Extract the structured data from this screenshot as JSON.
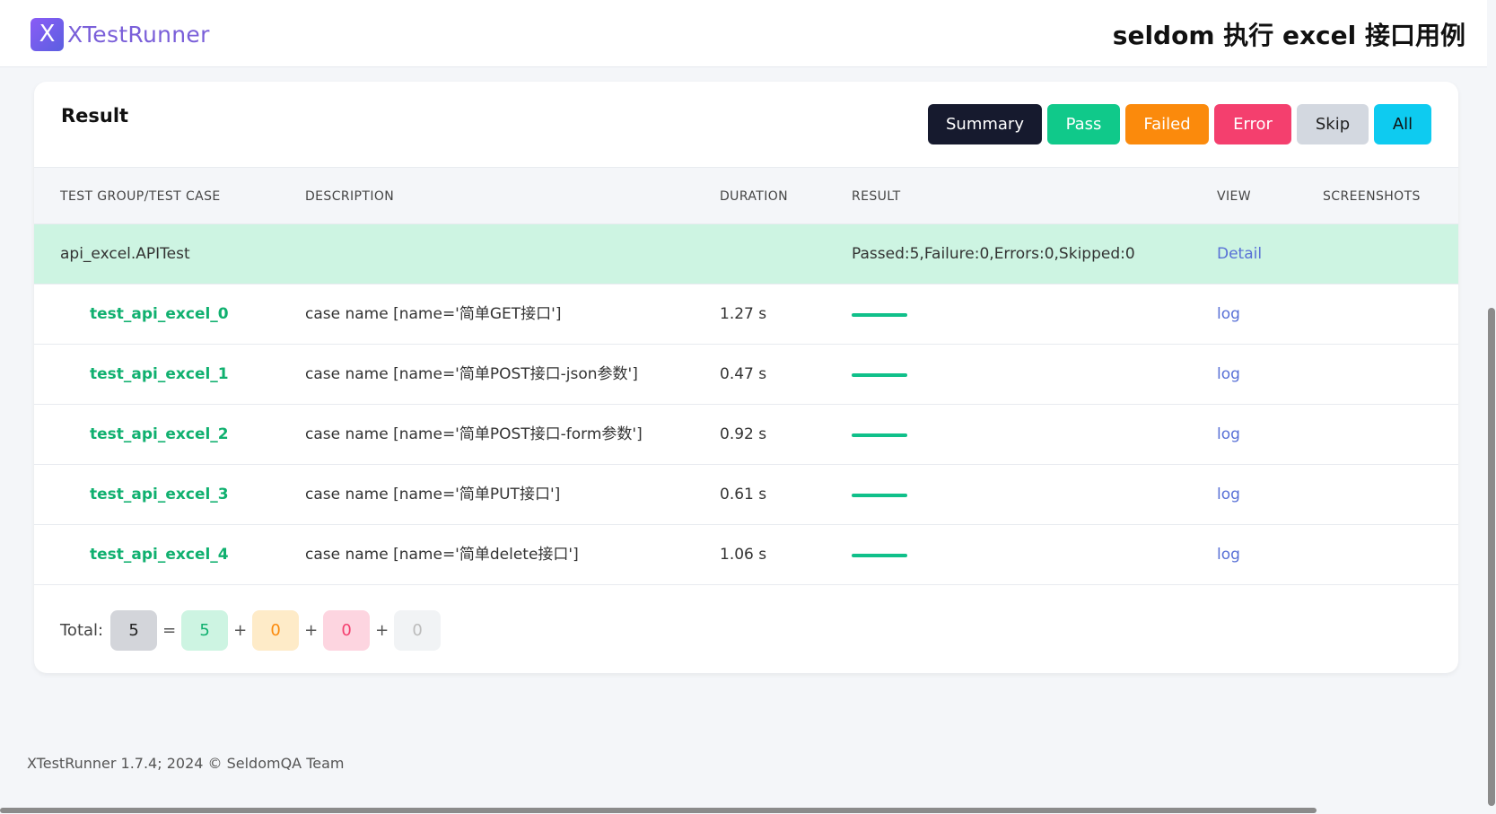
{
  "app": {
    "logo_letter": "X",
    "logo_text": "XTestRunner",
    "page_title": "seldom 执行 excel 接口用例"
  },
  "card": {
    "title": "Result",
    "filters": {
      "summary": "Summary",
      "pass": "Pass",
      "failed": "Failed",
      "error": "Error",
      "skip": "Skip",
      "all": "All"
    }
  },
  "table": {
    "headers": {
      "group_case": "TEST GROUP/TEST CASE",
      "description": "DESCRIPTION",
      "duration": "DURATION",
      "result": "RESULT",
      "view": "VIEW",
      "screenshots": "SCREENSHOTS"
    },
    "group": {
      "name": "api_excel.APITest",
      "result": "Passed:5,Failure:0,Errors:0,Skipped:0",
      "view": "Detail"
    },
    "cases": [
      {
        "name": "test_api_excel_0",
        "description": "case name [name='简单GET接口']",
        "duration": "1.27 s",
        "status": "pass",
        "view": "log"
      },
      {
        "name": "test_api_excel_1",
        "description": "case name [name='简单POST接口-json参数']",
        "duration": "0.47 s",
        "status": "pass",
        "view": "log"
      },
      {
        "name": "test_api_excel_2",
        "description": "case name [name='简单POST接口-form参数']",
        "duration": "0.92 s",
        "status": "pass",
        "view": "log"
      },
      {
        "name": "test_api_excel_3",
        "description": "case name [name='简单PUT接口']",
        "duration": "0.61 s",
        "status": "pass",
        "view": "log"
      },
      {
        "name": "test_api_excel_4",
        "description": "case name [name='简单delete接口']",
        "duration": "1.06 s",
        "status": "pass",
        "view": "log"
      }
    ]
  },
  "totals": {
    "label": "Total:",
    "total": "5",
    "eq": "=",
    "plus": "+",
    "pass": "5",
    "failed": "0",
    "error": "0",
    "skip": "0"
  },
  "footer": {
    "text": "XTestRunner 1.7.4; 2024 © SeldomQA Team"
  },
  "colors": {
    "pass": "#10c98a",
    "failed": "#fb8a0c",
    "error": "#f43f6e",
    "skip": "#d3d8e0",
    "all": "#0ecbf0",
    "summary": "#161a2e",
    "group_row_bg": "#cdf4e2"
  }
}
